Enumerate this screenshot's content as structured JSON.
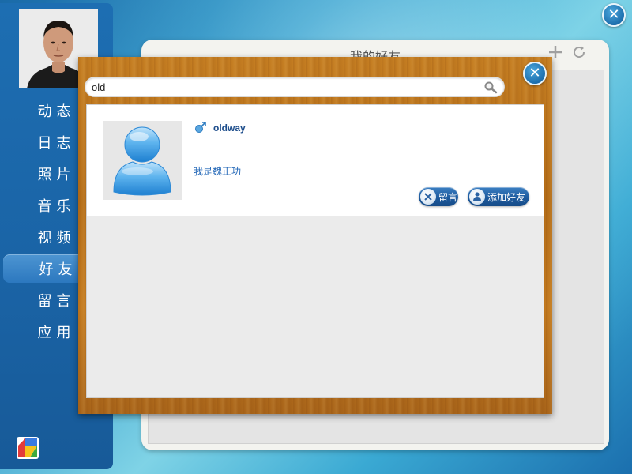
{
  "nav": {
    "items": [
      {
        "label": "动态"
      },
      {
        "label": "日志"
      },
      {
        "label": "照片"
      },
      {
        "label": "音乐"
      },
      {
        "label": "视频"
      },
      {
        "label": "好友",
        "active": true
      },
      {
        "label": "留言"
      },
      {
        "label": "应用"
      }
    ]
  },
  "friends_window": {
    "title": "我的好友",
    "add_icon": "plus-icon",
    "refresh_icon": "refresh-icon"
  },
  "search": {
    "value": "old",
    "icon": "magnifier-icon"
  },
  "result": {
    "username": "oldway",
    "gender": "male",
    "signature": "我是魏正功",
    "message_button": "留言",
    "add_friend_button": "添加好友"
  },
  "colors": {
    "sidebar": "#1d6eb2",
    "active_nav": "#2c78bf",
    "wood": "#c57e22",
    "link_blue": "#2569b8"
  }
}
